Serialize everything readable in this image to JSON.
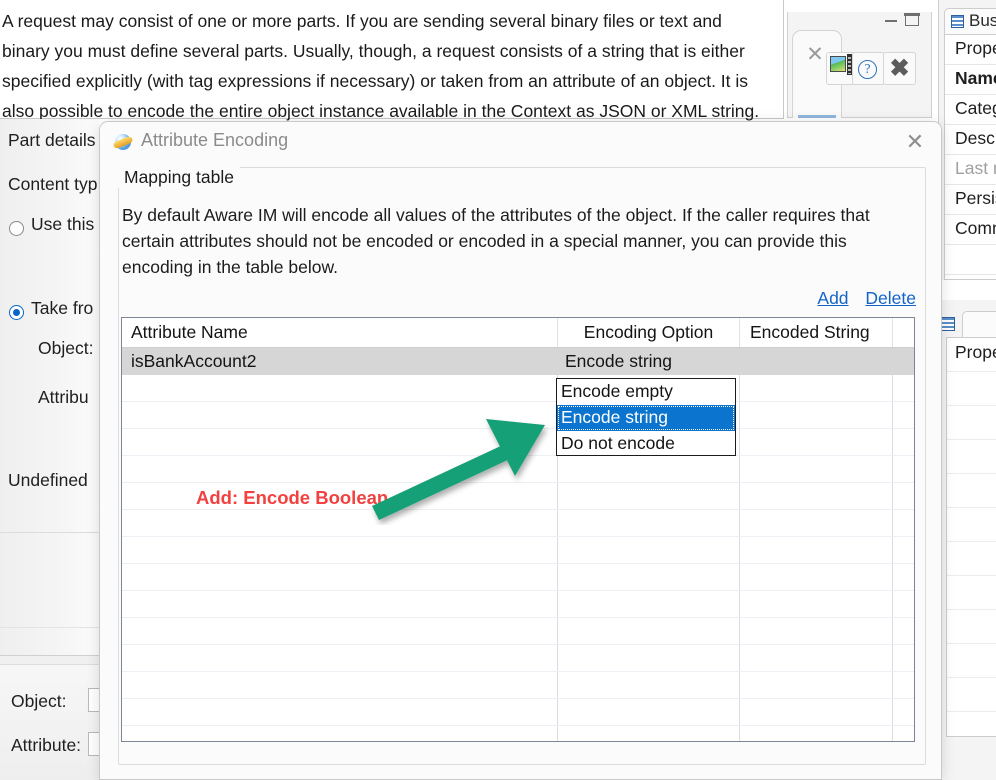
{
  "background": {
    "doc_text": "A request may consist of one or more parts. If you are sending several binary files or text and binary you must define several parts. Usually, though, a request consists of a string that is either specified explicitly (with tag expressions if necessary) or taken from an attribute of an object. It is also possible to encode the entire object instance available in the Context as JSON or XML string.",
    "left_panel": {
      "part_details_label": "Part details",
      "content_type_label": "Content typ",
      "use_this_label": "Use this",
      "take_from_label": "Take fro",
      "object_label": "Object:",
      "attribute_label": "Attribu",
      "undefined_label": "Undefined"
    },
    "bottom_panel": {
      "object_label": "Object:",
      "attribute_label": "Attribute:"
    },
    "toolbar": {
      "minimize_icon": "minimize-icon",
      "maximize_icon": "maximize-icon",
      "tab_close_icon": "close-icon",
      "image_icon": "image-icon",
      "help_glyph": "?",
      "close_glyph": "✖"
    },
    "dock_top": {
      "tab_label": "Busin",
      "rows": [
        "Prope",
        "Name",
        "Categ",
        "Descri",
        "Last m",
        "Persist",
        "Comn"
      ]
    },
    "dock_bottom": {
      "rows": [
        "Prope"
      ]
    }
  },
  "dialog": {
    "title": "Attribute Encoding",
    "app_icon": "aware-im-icon",
    "close_icon": "close-icon",
    "group_legend": "Mapping table",
    "description": "By default Aware IM will encode all values of the attributes of the object. If the caller requires that certain attributes should not be encoded or encoded in a special manner, you can provide this encoding in the table below.",
    "links": {
      "add": "Add",
      "delete": "Delete"
    },
    "table": {
      "columns": [
        "Attribute Name",
        "Encoding Option",
        "Encoded String",
        ""
      ],
      "rows": [
        {
          "attribute_name": "isBankAccount2",
          "encoding_option": "Encode string",
          "encoded_string": "",
          "selected": true
        }
      ],
      "empty_row_count": 13
    },
    "dropdown": {
      "open": true,
      "options": [
        "Encode empty",
        "Encode string",
        "Do not encode"
      ],
      "selected": "Encode string",
      "selected_index": 1,
      "highlight_color": "#0a74cf"
    }
  },
  "annotations": {
    "note_text": "Add:  Encode Boolean",
    "note_color": "#f2413e",
    "arrow_color": "#16a077",
    "arrow_name": "green-arrow-pointer"
  }
}
